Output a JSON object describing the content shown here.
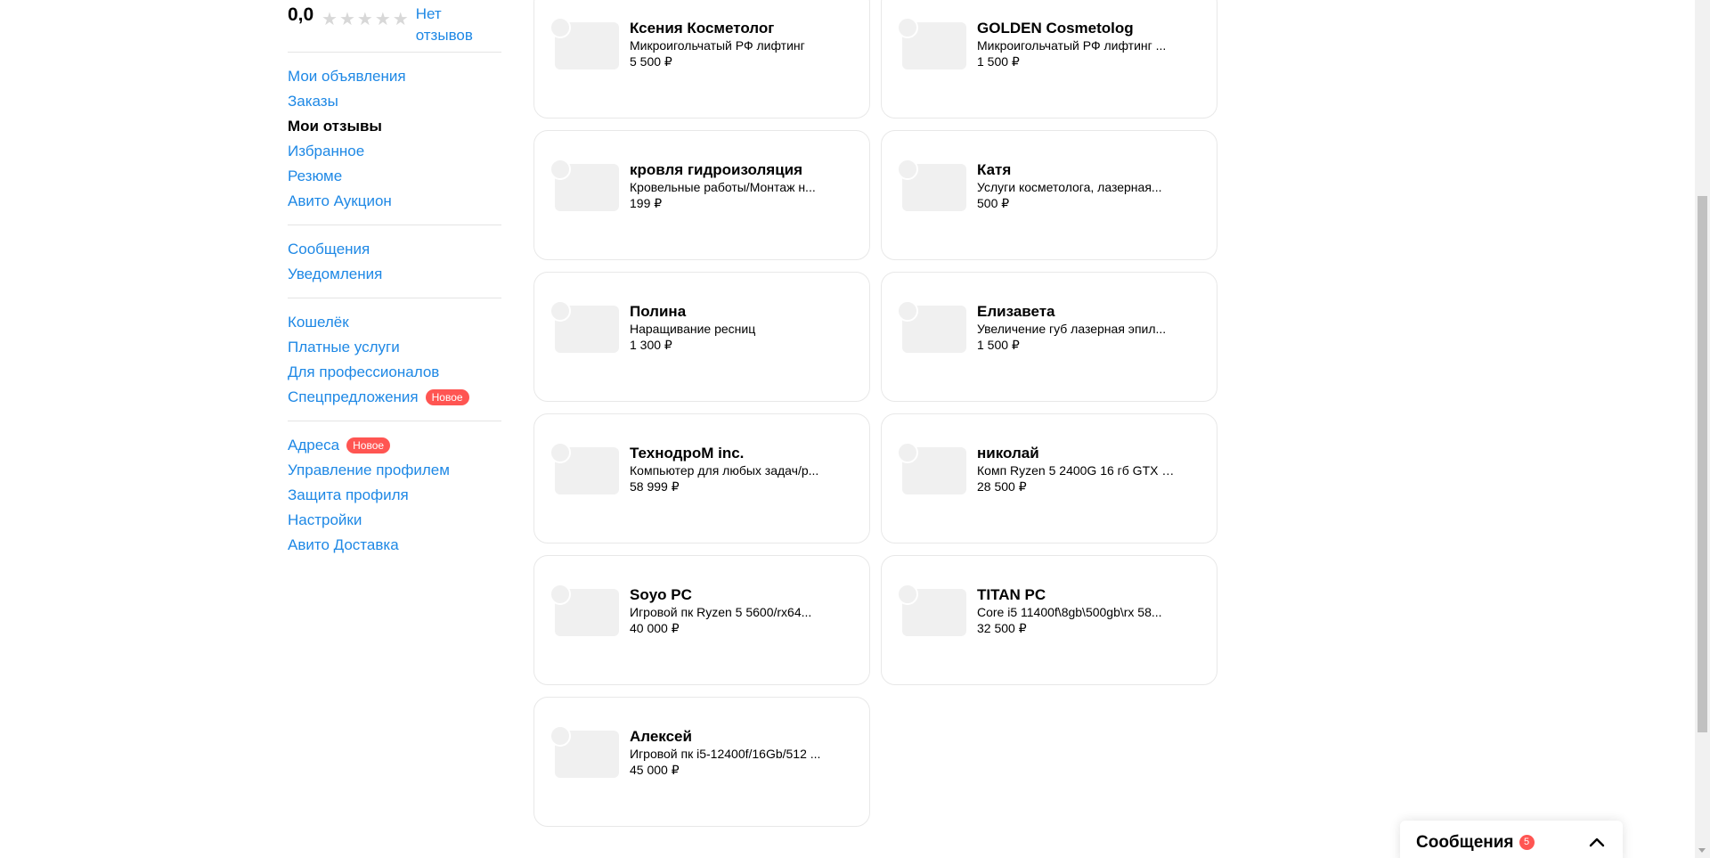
{
  "sidebar": {
    "rating_value": "0,0",
    "stars_total": 5,
    "stars_filled": 0,
    "no_reviews_label": "Нет отзывов",
    "groups": [
      [
        {
          "label": "Мои объявления",
          "active": false,
          "badge": ""
        },
        {
          "label": "Заказы",
          "active": false,
          "badge": ""
        },
        {
          "label": "Мои отзывы",
          "active": true,
          "badge": ""
        },
        {
          "label": "Избранное",
          "active": false,
          "badge": ""
        },
        {
          "label": "Резюме",
          "active": false,
          "badge": ""
        },
        {
          "label": "Авито Аукцион",
          "active": false,
          "badge": ""
        }
      ],
      [
        {
          "label": "Сообщения",
          "active": false,
          "badge": ""
        },
        {
          "label": "Уведомления",
          "active": false,
          "badge": ""
        }
      ],
      [
        {
          "label": "Кошелёк",
          "active": false,
          "badge": ""
        },
        {
          "label": "Платные услуги",
          "active": false,
          "badge": ""
        },
        {
          "label": "Для профессионалов",
          "active": false,
          "badge": ""
        },
        {
          "label": "Спецпредложения",
          "active": false,
          "badge": "Новое"
        }
      ],
      [
        {
          "label": "Адреса",
          "active": false,
          "badge": "Новое"
        },
        {
          "label": "Управление профилем",
          "active": false,
          "badge": ""
        },
        {
          "label": "Защита профиля",
          "active": false,
          "badge": ""
        },
        {
          "label": "Настройки",
          "active": false,
          "badge": ""
        },
        {
          "label": "Авито Доставка",
          "active": false,
          "badge": ""
        }
      ]
    ]
  },
  "cards": [
    {
      "name": "Ксения Косметолог",
      "desc": "Микроигольчатый РФ лифтинг",
      "price": "5 500 ₽"
    },
    {
      "name": "GOLDEN Cosmetolog",
      "desc": "Микроигольчатый РФ лифтинг ...",
      "price": "1 500 ₽"
    },
    {
      "name": "кровля гидроизоляция",
      "desc": "Кровельные работы/Монтаж н...",
      "price": "199 ₽"
    },
    {
      "name": "Катя",
      "desc": "Услуги косметолога, лазерная...",
      "price": "500 ₽"
    },
    {
      "name": "Полина",
      "desc": "Наращивание ресниц",
      "price": "1 300 ₽"
    },
    {
      "name": "Елизавета",
      "desc": "Увеличение губ лазерная эпил...",
      "price": "1 500 ₽"
    },
    {
      "name": "ТехнодроМ inc.",
      "desc": "Компьютер для любых задач/р...",
      "price": "58 999 ₽"
    },
    {
      "name": "николай",
      "desc": "Комп Ryzen 5 2400G 16 гб GTX 1...",
      "price": "28 500 ₽"
    },
    {
      "name": "Soyo PC",
      "desc": "Игровой пк Ryzen 5 5600/rx64...",
      "price": "40 000 ₽"
    },
    {
      "name": "TITAN PC",
      "desc": "Core i5 11400f\\8gb\\500gb\\rx 58...",
      "price": "32 500 ₽"
    },
    {
      "name": "Алексей",
      "desc": "Игровой пк i5-12400f/16Gb/512 ...",
      "price": "45 000 ₽"
    }
  ],
  "messenger": {
    "title": "Сообщения",
    "unread_count": "5"
  },
  "colors": {
    "link": "#1e88e5",
    "badge": "#ff5552",
    "star_empty": "#d8d8d8",
    "placeholder": "#f0f0f0"
  }
}
